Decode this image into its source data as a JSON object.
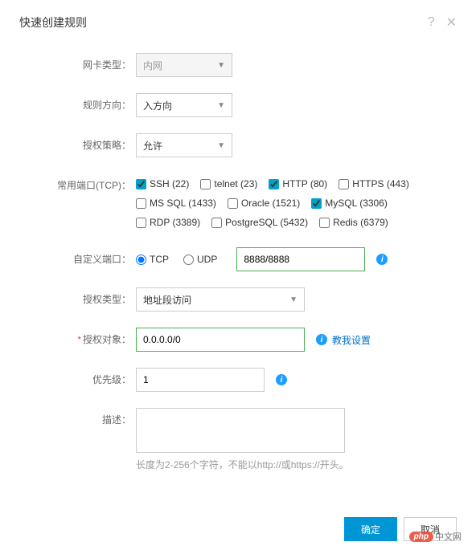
{
  "header": {
    "title": "快速创建规则",
    "help_icon": "?",
    "close_icon": "✕"
  },
  "fields": {
    "nic_type": {
      "label": "网卡类型：",
      "value": "内网"
    },
    "direction": {
      "label": "规则方向：",
      "value": "入方向"
    },
    "auth_policy": {
      "label": "授权策略：",
      "value": "允许"
    },
    "common_ports": {
      "label": "常用端口(TCP)：",
      "items": [
        {
          "label": "SSH (22)",
          "checked": true
        },
        {
          "label": "telnet (23)",
          "checked": false
        },
        {
          "label": "HTTP (80)",
          "checked": true
        },
        {
          "label": "HTTPS (443)",
          "checked": false
        },
        {
          "label": "MS SQL (1433)",
          "checked": false
        },
        {
          "label": "Oracle (1521)",
          "checked": false
        },
        {
          "label": "MySQL (3306)",
          "checked": true
        },
        {
          "label": "RDP (3389)",
          "checked": false
        },
        {
          "label": "PostgreSQL (5432)",
          "checked": false
        },
        {
          "label": "Redis (6379)",
          "checked": false
        }
      ]
    },
    "custom_port": {
      "label": "自定义端口：",
      "protocols": {
        "tcp": "TCP",
        "udp": "UDP",
        "selected": "tcp"
      },
      "value": "8888/8888"
    },
    "auth_type": {
      "label": "授权类型：",
      "value": "地址段访问"
    },
    "auth_object": {
      "label": "授权对象：",
      "value": "0.0.0.0/0",
      "help_link": "教我设置"
    },
    "priority": {
      "label": "优先级：",
      "value": "1"
    },
    "description": {
      "label": "描述：",
      "value": "",
      "hint": "长度为2-256个字符，不能以http://或https://开头。"
    }
  },
  "footer": {
    "ok": "确定",
    "cancel": "取消"
  },
  "watermark": {
    "badge": "php",
    "text": "中文网"
  }
}
